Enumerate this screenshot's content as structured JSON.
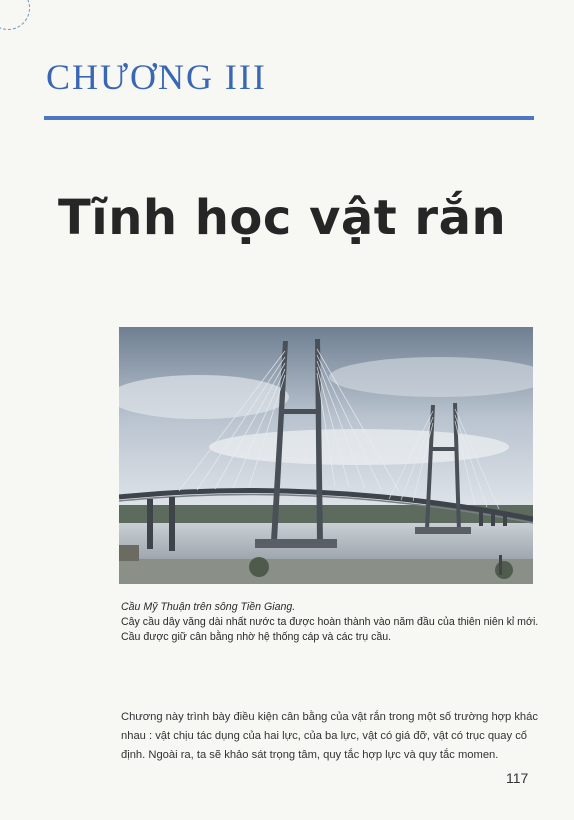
{
  "chapter_label": "CHƯƠNG III",
  "chapter_title": "Tĩnh học vật rắn",
  "photo": {
    "caption_title": "Cầu Mỹ Thuận trên sông Tiền Giang.",
    "caption_text": "Cây cầu dây văng dài nhất nước ta được hoàn thành vào năm đầu của thiên niên kỉ mới. Cầu được giữ cân bằng nhờ hệ thống cáp và các trụ cầu."
  },
  "intro_text": "Chương này trình bày điều kiện cân bằng của vật rắn trong một số trường hợp khác nhau : vật chịu tác dụng của hai lực, của ba lực, vật có giá đỡ, vật có trục quay cố định. Ngoài ra, ta sẽ khảo sát trọng tâm, quy tắc hợp lực và quy tắc momen.",
  "page_number": "117",
  "colors": {
    "accent_blue": "#3a67b4",
    "rule_blue": "#4b78c0",
    "title_black": "#262626"
  }
}
